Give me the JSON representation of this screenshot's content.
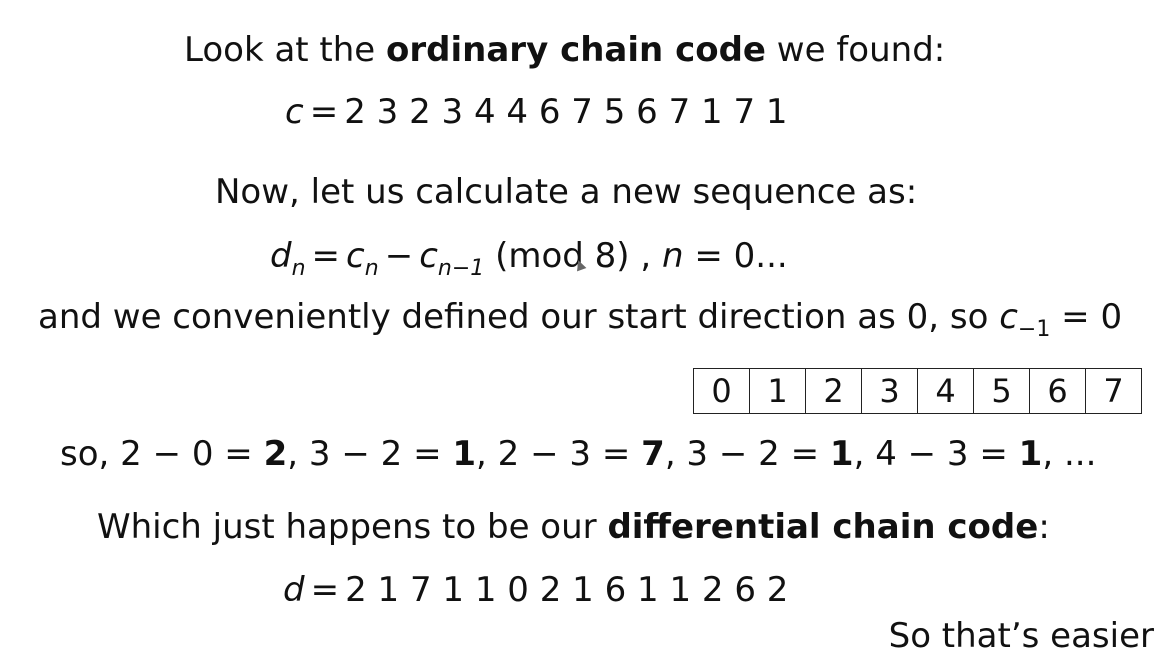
{
  "line1": {
    "prefix": "Look at the",
    "bold": "ordinary chain code",
    "suffix": "we found:"
  },
  "eq_c": {
    "var": "c",
    "eq": "=",
    "values": "2 3 2 3 4 4 6 7 5 6 7 1 7 1"
  },
  "line3": "Now, let us calculate a new sequence as:",
  "eq_d_def": {
    "lhs": "d",
    "lhs_sub": "n",
    "eq": "=",
    "c1": "c",
    "c1_sub": "n",
    "minus": "−",
    "c2": "c",
    "c2_sub": "n−1",
    "mod": "(mod 8) ,",
    "n": "n",
    "range": "= 0..."
  },
  "line5": {
    "text": "and we conveniently defined our start direction as 0, so",
    "var": "c",
    "sub": "−1",
    "tail": "= 0"
  },
  "directions": [
    "0",
    "1",
    "2",
    "3",
    "4",
    "5",
    "6",
    "7"
  ],
  "line6": {
    "prefix": "so, 2 − 0 =",
    "r1": "2",
    "s2": ", 3 − 2 =",
    "r2": "1",
    "s3": ", 2 − 3 =",
    "r3": "7",
    "s4": ", 3 − 2 =",
    "r4": "1",
    "s5": ", 4 − 3 =",
    "r5": "1",
    "tail": ", ..."
  },
  "line7": {
    "prefix": "Which just happens to be our",
    "bold": "differential chain code",
    "suffix": ":"
  },
  "eq_d": {
    "var": "d",
    "eq": "=",
    "values": "2 1 7 1 1 0 2 1 6 1 1 2 6 2"
  },
  "footer": "So that’s easier"
}
